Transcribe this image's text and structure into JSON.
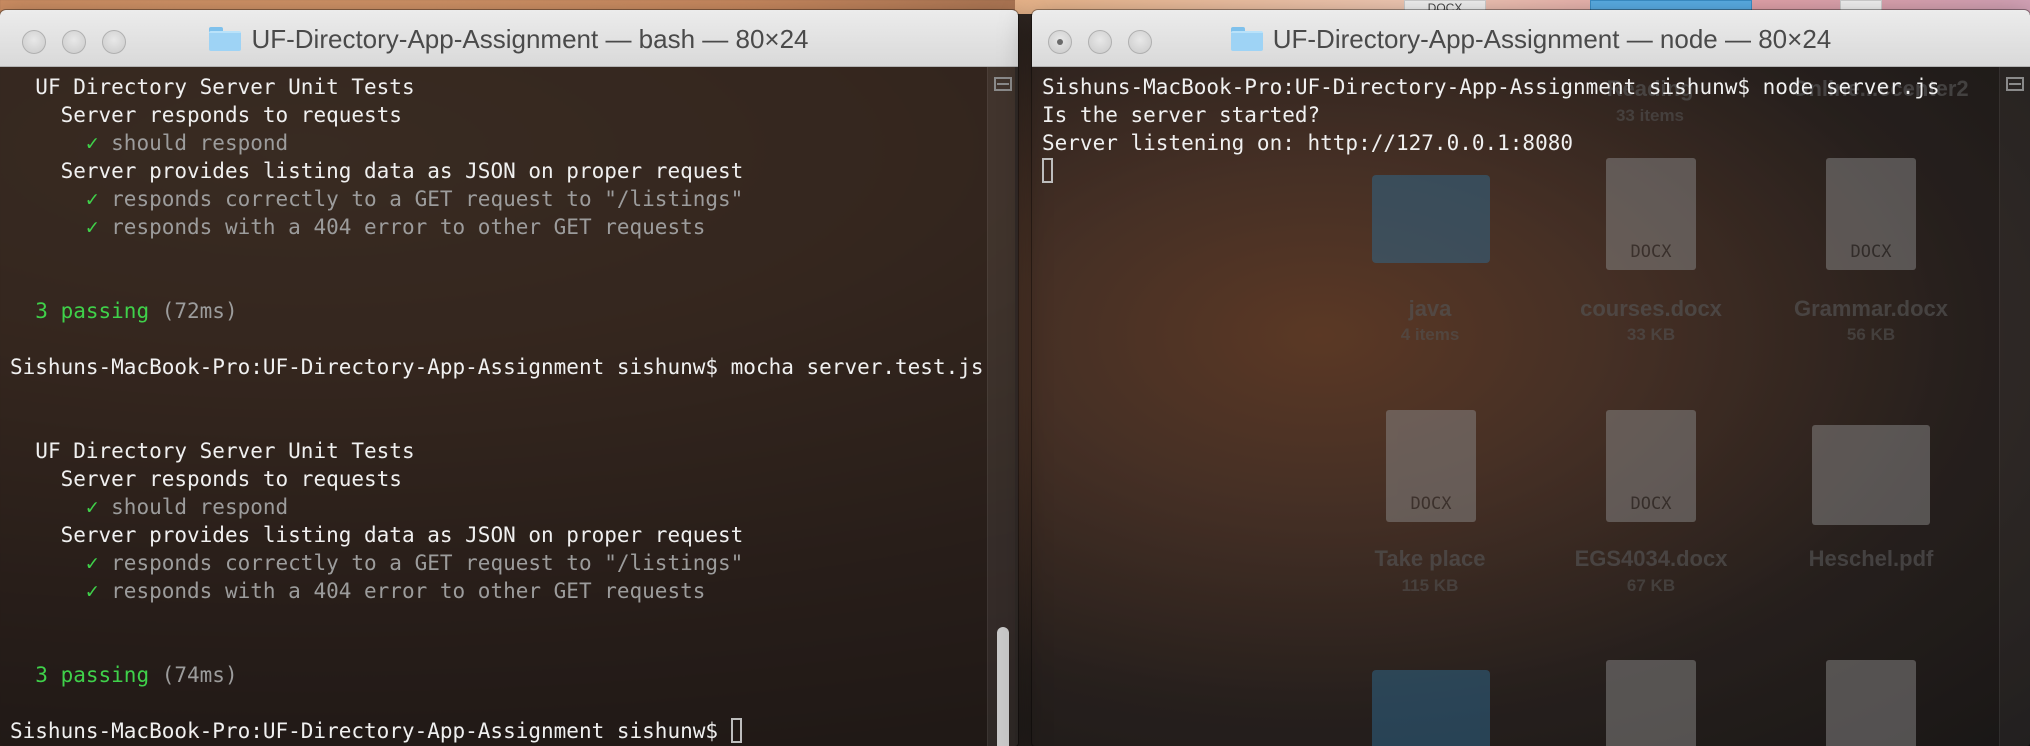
{
  "desktop": {
    "top_chip": "DOCX",
    "items": [
      {
        "name": "java",
        "sub": "4 items",
        "kind": "folder"
      },
      {
        "name": "courses.docx",
        "sub": "33 KB",
        "kind": "docx"
      },
      {
        "name": "Grammar.docx",
        "sub": "56 KB",
        "kind": "docx"
      },
      {
        "name": "Take place",
        "sub": "115 KB",
        "kind": "docx"
      },
      {
        "name": "EGS4034.docx",
        "sub": "67 KB",
        "kind": "docx"
      },
      {
        "name": "Heschel.pdf",
        "sub": "",
        "kind": "pdf"
      }
    ],
    "partial_labels": [
      "Reading",
      "33 items",
      "Online...ccenter2"
    ],
    "docx_tag": "DOCX"
  },
  "left_window": {
    "title": "UF-Directory-App-Assignment — bash — 80×24",
    "lines": [
      {
        "indent": "  ",
        "text": "UF Directory Server Unit Tests",
        "style": ""
      },
      {
        "indent": "    ",
        "text": "Server responds to requests",
        "style": ""
      },
      {
        "indent": "      ",
        "check": "✓",
        "text": " should respond",
        "style": "gray"
      },
      {
        "indent": "    ",
        "text": "Server provides listing data as JSON on proper request",
        "style": ""
      },
      {
        "indent": "      ",
        "check": "✓",
        "text": " responds correctly to a GET request to \"/listings\"",
        "style": "gray"
      },
      {
        "indent": "      ",
        "check": "✓",
        "text": " responds with a 404 error to other GET requests",
        "style": "gray"
      },
      {
        "indent": "",
        "text": "",
        "style": ""
      },
      {
        "indent": "",
        "text": "",
        "style": ""
      },
      {
        "indent": "  ",
        "pass": "3 passing",
        "text": " (72ms)",
        "style": "gray"
      },
      {
        "indent": "",
        "text": "",
        "style": ""
      },
      {
        "indent": "",
        "text": "Sishuns-MacBook-Pro:UF-Directory-App-Assignment sishunw$ mocha server.test.js",
        "style": ""
      },
      {
        "indent": "",
        "text": "",
        "style": ""
      },
      {
        "indent": "",
        "text": "",
        "style": ""
      },
      {
        "indent": "  ",
        "text": "UF Directory Server Unit Tests",
        "style": ""
      },
      {
        "indent": "    ",
        "text": "Server responds to requests",
        "style": ""
      },
      {
        "indent": "      ",
        "check": "✓",
        "text": " should respond",
        "style": "gray"
      },
      {
        "indent": "    ",
        "text": "Server provides listing data as JSON on proper request",
        "style": ""
      },
      {
        "indent": "      ",
        "check": "✓",
        "text": " responds correctly to a GET request to \"/listings\"",
        "style": "gray"
      },
      {
        "indent": "      ",
        "check": "✓",
        "text": " responds with a 404 error to other GET requests",
        "style": "gray"
      },
      {
        "indent": "",
        "text": "",
        "style": ""
      },
      {
        "indent": "",
        "text": "",
        "style": ""
      },
      {
        "indent": "  ",
        "pass": "3 passing",
        "text": " (74ms)",
        "style": "gray"
      },
      {
        "indent": "",
        "text": "",
        "style": ""
      },
      {
        "indent": "",
        "text": "Sishuns-MacBook-Pro:UF-Directory-App-Assignment sishunw$ ",
        "style": "",
        "cursor": true
      }
    ],
    "scroll_position": 0.9
  },
  "right_window": {
    "title": "UF-Directory-App-Assignment — node — 80×24",
    "lines": [
      {
        "indent": "",
        "text": "Sishuns-MacBook-Pro:UF-Directory-App-Assignment sishunw$ node server.js",
        "style": ""
      },
      {
        "indent": "",
        "text": "Is the server started?",
        "style": ""
      },
      {
        "indent": "",
        "text": "Server listening on: http://127.0.0.1:8080",
        "style": ""
      },
      {
        "indent": "",
        "text": "",
        "style": "",
        "cursor": true
      }
    ]
  },
  "colors": {
    "pass_green": "#3fd14a",
    "muted_gray": "#9c9c9c",
    "terminal_text": "#f0f0f0"
  }
}
